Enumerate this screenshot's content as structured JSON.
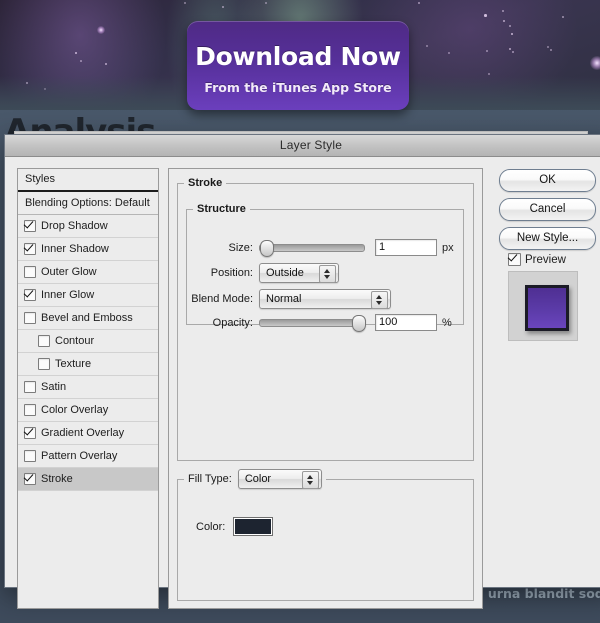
{
  "background": {
    "download_button": {
      "title": "Download Now",
      "subtitle": "From the iTunes App Store",
      "color": "#5a31a0"
    },
    "page_heading": "Analysis",
    "bullet_text": "Phasellus quis odio in urna blandit sodales",
    "body_color": "#44526 4"
  },
  "dialog": {
    "title": "Layer Style",
    "styles_panel": {
      "header": "Styles",
      "items": [
        {
          "label": "Blending Options: Default",
          "checkbox": false,
          "has_checkbox": false,
          "indent": false,
          "selected": false
        },
        {
          "label": "Drop Shadow",
          "checkbox": true,
          "has_checkbox": true,
          "indent": false,
          "selected": false
        },
        {
          "label": "Inner Shadow",
          "checkbox": true,
          "has_checkbox": true,
          "indent": false,
          "selected": false
        },
        {
          "label": "Outer Glow",
          "checkbox": false,
          "has_checkbox": true,
          "indent": false,
          "selected": false
        },
        {
          "label": "Inner Glow",
          "checkbox": true,
          "has_checkbox": true,
          "indent": false,
          "selected": false
        },
        {
          "label": "Bevel and Emboss",
          "checkbox": false,
          "has_checkbox": true,
          "indent": false,
          "selected": false
        },
        {
          "label": "Contour",
          "checkbox": false,
          "has_checkbox": true,
          "indent": true,
          "selected": false
        },
        {
          "label": "Texture",
          "checkbox": false,
          "has_checkbox": true,
          "indent": true,
          "selected": false
        },
        {
          "label": "Satin",
          "checkbox": false,
          "has_checkbox": true,
          "indent": false,
          "selected": false
        },
        {
          "label": "Color Overlay",
          "checkbox": false,
          "has_checkbox": true,
          "indent": false,
          "selected": false
        },
        {
          "label": "Gradient Overlay",
          "checkbox": true,
          "has_checkbox": true,
          "indent": false,
          "selected": false
        },
        {
          "label": "Pattern Overlay",
          "checkbox": false,
          "has_checkbox": true,
          "indent": false,
          "selected": false
        },
        {
          "label": "Stroke",
          "checkbox": true,
          "has_checkbox": true,
          "indent": false,
          "selected": true
        }
      ]
    },
    "stroke": {
      "group_label": "Stroke",
      "structure": {
        "group_label": "Structure",
        "size": {
          "label": "Size:",
          "value": "1",
          "unit": "px",
          "slider_percent": 1
        },
        "position": {
          "label": "Position:",
          "value": "Outside"
        },
        "blend_mode": {
          "label": "Blend Mode:",
          "value": "Normal"
        },
        "opacity": {
          "label": "Opacity:",
          "value": "100",
          "unit": "%",
          "slider_percent": 100
        }
      },
      "fill": {
        "fill_type_label": "Fill Type:",
        "fill_type_value": "Color",
        "color_label": "Color:",
        "color_value": "#1d2430"
      }
    },
    "buttons": {
      "ok": "OK",
      "cancel": "Cancel",
      "new_style": "New Style...",
      "preview_label": "Preview",
      "preview_checked": true
    },
    "preview_swatch_color": "#5a3aa6"
  }
}
